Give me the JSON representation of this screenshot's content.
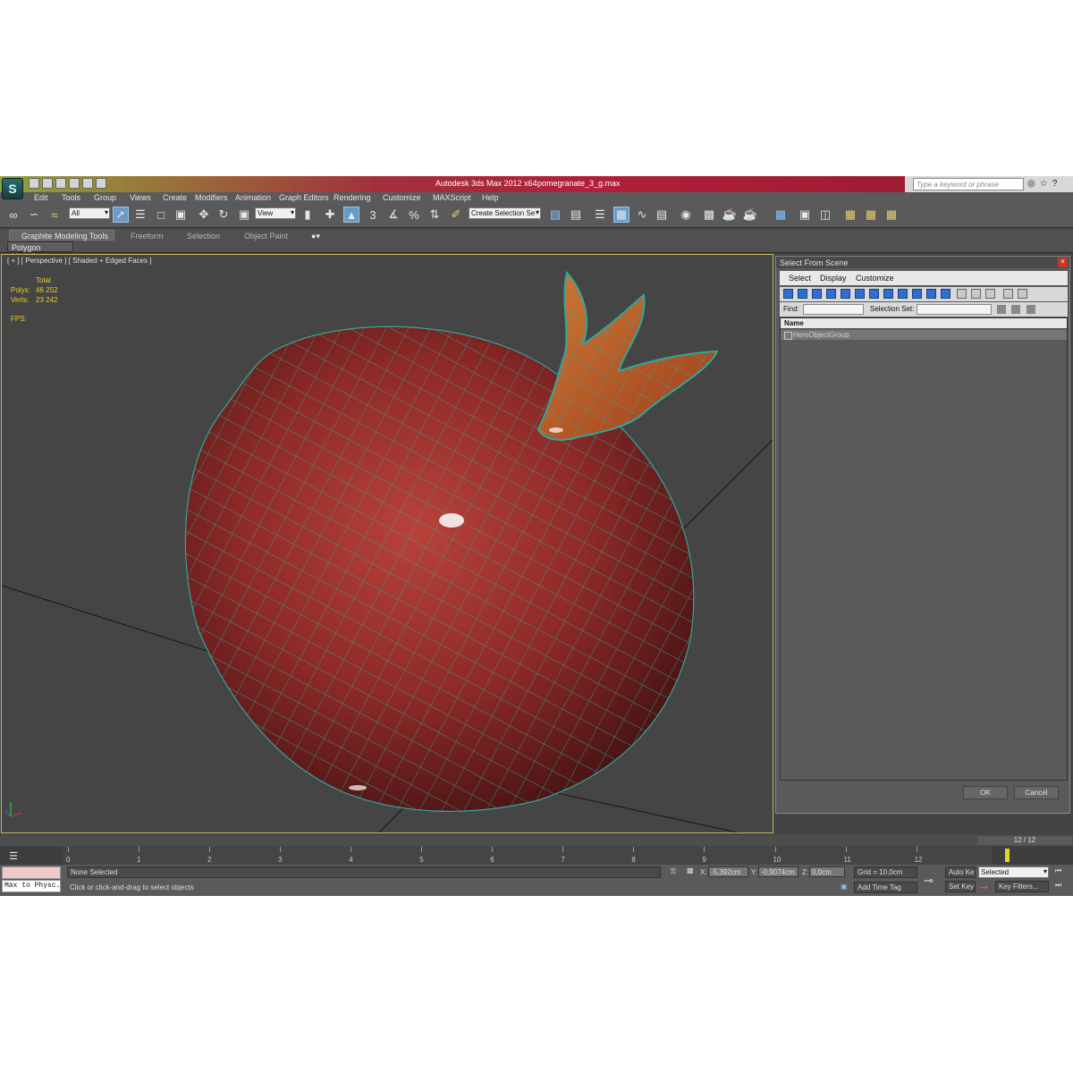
{
  "window": {
    "app_title": "Autodesk 3ds Max  2012 x64",
    "file_name": "pomegranate_3_g.max",
    "search_placeholder": "Type a keyword or phrase"
  },
  "menu": [
    "Edit",
    "Tools",
    "Group",
    "Views",
    "Create",
    "Modifiers",
    "Animation",
    "Graph Editors",
    "Rendering",
    "Customize",
    "MAXScript",
    "Help"
  ],
  "toolbar": {
    "filter_value": "All",
    "ref_coord_value": "View",
    "selection_set_value": "Create Selection Se",
    "snap_label": "3"
  },
  "ribbon": {
    "tabs": [
      "Graphite Modeling Tools",
      "Freeform",
      "Selection",
      "Object Paint"
    ],
    "active_subtab": "Polygon Modeling"
  },
  "viewport": {
    "label": "[ + ] [ Perspective ] [ Shaded + Edged Faces ]",
    "stats_header": "Total",
    "polys_label": "Polys:",
    "polys_value": "46 252",
    "verts_label": "Verts:",
    "verts_value": "23 242",
    "fps_label": "FPS:",
    "wire_color": "#2fa89a",
    "fruit_color": "#8e2a28"
  },
  "dialog": {
    "title": "Select From Scene",
    "menu": [
      "Select",
      "Display",
      "Customize"
    ],
    "find_label": "Find:",
    "selection_set_label": "Selection Set:",
    "column_name": "Name",
    "rows": [
      "HeroObjectGroup"
    ],
    "ok_label": "OK",
    "cancel_label": "Cancel"
  },
  "timeline": {
    "frame_display": "12 / 12",
    "ticks": [
      "0",
      "1",
      "2",
      "3",
      "4",
      "5",
      "6",
      "7",
      "8",
      "9",
      "10",
      "11",
      "12"
    ]
  },
  "status": {
    "maxscript_text": "Max to Physc.",
    "selection_status": "None Selected",
    "prompt": "Click or click-and-drag to select objects",
    "x_label": "X:",
    "x_value": "-5,392cm",
    "y_label": "Y:",
    "y_value": "-0,9074cm",
    "z_label": "Z:",
    "z_value": "0,0cm",
    "grid": "Grid = 10,0cm",
    "add_time_tag": "Add Time Tag",
    "auto_key": "Auto Key",
    "set_key": "Set Key",
    "key_mode_value": "Selected",
    "key_filters": "Key Filters..."
  }
}
